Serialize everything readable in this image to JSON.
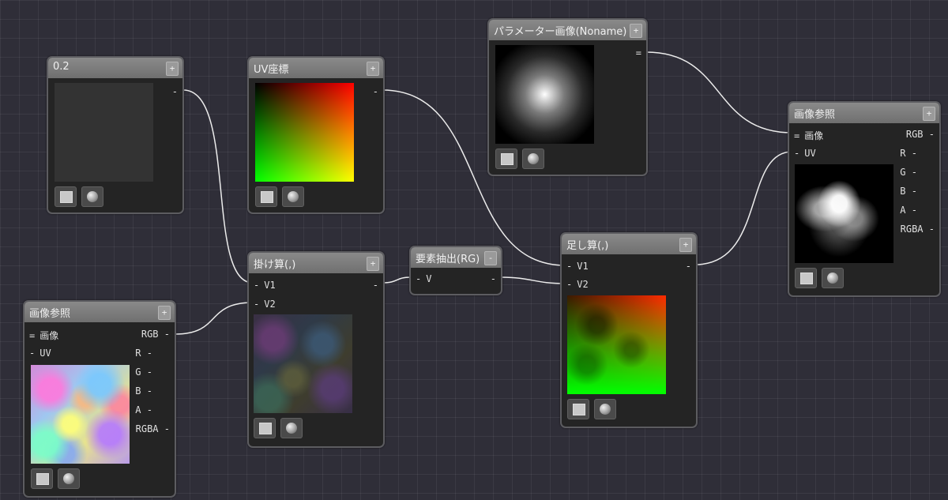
{
  "nodes": {
    "constant": {
      "title": "0.2",
      "out_label": "-"
    },
    "uv": {
      "title": "UV座標",
      "out_label": "-"
    },
    "param_image": {
      "title": "パラメーター画像(Noname)",
      "out_label": "="
    },
    "image_ref_bottom": {
      "title": "画像参照",
      "inputs": [
        "画像",
        "UV"
      ],
      "input_marks": [
        "=",
        "-"
      ],
      "outputs": [
        "RGB",
        "R",
        "G",
        "B",
        "A",
        "RGBA"
      ]
    },
    "multiply": {
      "title": "掛け算(,)",
      "inputs": [
        "V1",
        "V2"
      ],
      "input_marks": [
        "-",
        "-"
      ],
      "out_label": "-"
    },
    "extract": {
      "title": "要素抽出(RG)",
      "inputs": [
        "V"
      ],
      "input_marks": [
        "-"
      ],
      "out_label": "-"
    },
    "add": {
      "title": "足し算(,)",
      "inputs": [
        "V1",
        "V2"
      ],
      "input_marks": [
        "-",
        "-"
      ],
      "out_label": "-"
    },
    "image_ref_right": {
      "title": "画像参照",
      "inputs": [
        "画像",
        "UV"
      ],
      "input_marks": [
        "=",
        "-"
      ],
      "outputs": [
        "RGB",
        "R",
        "G",
        "B",
        "A",
        "RGBA"
      ]
    }
  },
  "plus_symbol": "+",
  "minus_symbol": "-"
}
